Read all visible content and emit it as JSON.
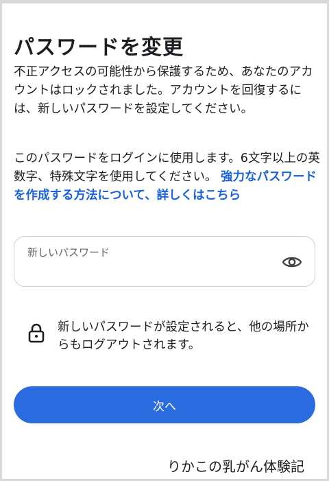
{
  "header": {
    "title": "パスワードを変更"
  },
  "intro": {
    "text": "不正アクセスの可能性から保護するため、あなたのアカウントはロックされました。アカウントを回復するには、新しいパスワードを設定してください。"
  },
  "requirements": {
    "text": "このパスワードをログインに使用します。6文字以上の英数字、特殊文字を使用してください。 ",
    "link": "強力なパスワードを作成する方法について、詳しくはこちら"
  },
  "password_field": {
    "label": "新しいパスワード",
    "value": "",
    "toggle_icon": "eye-icon"
  },
  "notice": {
    "icon": "lock-icon",
    "text": "新しいパスワードが設定されると、他の場所からもログアウトされます。"
  },
  "actions": {
    "next_label": "次へ"
  },
  "watermark": {
    "text": "りかこの乳がん体験記"
  },
  "colors": {
    "primary": "#2b6be0",
    "link": "#1a62d6",
    "text": "#1c1e21",
    "muted": "#65676b"
  }
}
